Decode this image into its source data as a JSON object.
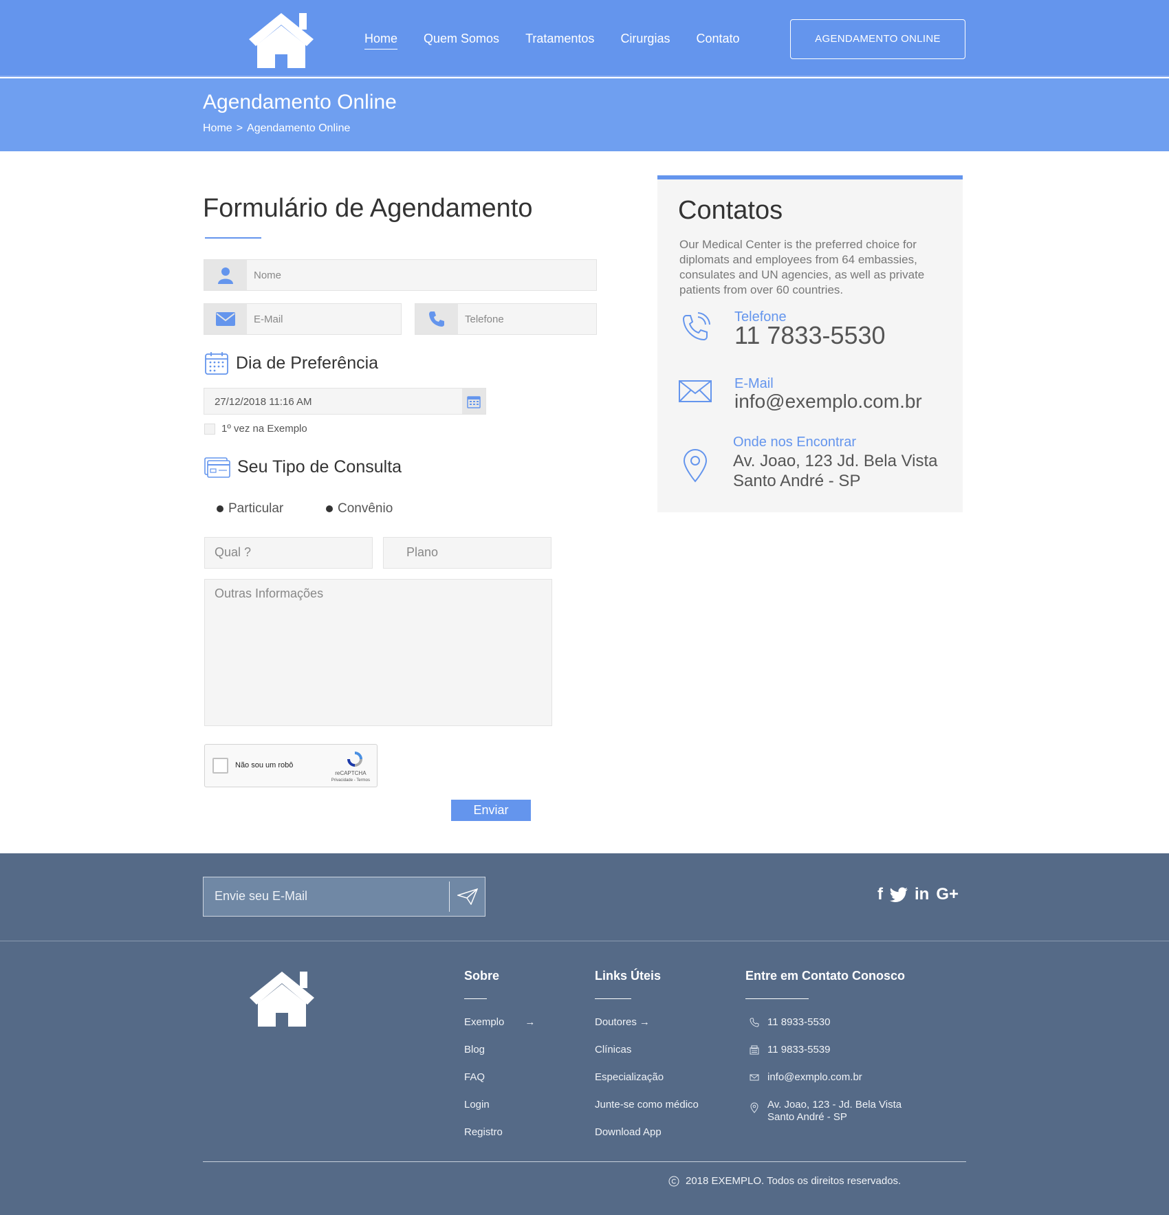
{
  "header": {
    "nav": [
      "Home",
      "Quem Somos",
      "Tratamentos",
      "Cirurgias",
      "Contato"
    ],
    "cta_label": "AGENDAMENTO ONLINE",
    "brand_color": "#6495ed"
  },
  "page_band": {
    "title": "Agendamento Online",
    "breadcrumb_home": "Home",
    "breadcrumb_sep": ">",
    "breadcrumb_current": "Agendamento Online"
  },
  "form": {
    "title": "Formulário de Agendamento",
    "name_placeholder": "Nome",
    "email_placeholder": "E-Mail",
    "phone_placeholder": "Telefone",
    "preference_heading": "Dia de Preferência",
    "date_value": "27/12/2018 11:16 AM",
    "first_time_label": "1º vez na Exemplo",
    "consult_heading": "Seu Tipo de Consulta",
    "radio_particular": "Particular",
    "radio_convenio": "Convênio",
    "qual_placeholder": "Qual ?",
    "plano_placeholder": "Plano",
    "other_info_placeholder": "Outras Informações",
    "captcha_label": "Não sou um robô",
    "captcha_brand": "reCAPTCHA",
    "captcha_links": "Privacidade - Termos",
    "submit_label": "Enviar"
  },
  "contacts": {
    "title": "Contatos",
    "description": "Our Medical Center is the preferred choice for diplomats and employees from 64 embassies, consulates and UN agencies, as well as private patients from over 60 countries.",
    "phone_label": "Telefone",
    "phone_value": "11 7833-5530",
    "email_label": "E-Mail",
    "email_value": "info@exemplo.com.br",
    "address_label": "Onde nos Encontrar",
    "address_line1": "Av. Joao, 123 Jd. Bela Vista",
    "address_line2": "Santo André - SP"
  },
  "footer": {
    "newsletter_placeholder": "Envie seu E-Mail",
    "social": [
      "f",
      "twitter",
      "in",
      "G+"
    ],
    "sobre": {
      "title": "Sobre",
      "links": [
        "Exemplo",
        "Blog",
        "FAQ",
        "Login",
        "Registro"
      ]
    },
    "links_uteis": {
      "title": "Links Úteis",
      "links": [
        "Doutores",
        "Clínicas",
        "Especialização",
        "Junte-se como médico",
        "Download App"
      ]
    },
    "contato": {
      "title": "Entre em Contato Conosco",
      "phone1": "11 8933-5530",
      "phone2": "11 9833-5539",
      "email": "info@exmplo.com.br",
      "address_line1": "Av. Joao, 123 - Jd. Bela Vista",
      "address_line2": "Santo André - SP"
    },
    "copyright": "2018 EXEMPLO. Todos os direitos reservados.",
    "bg_color": "#556a87"
  }
}
